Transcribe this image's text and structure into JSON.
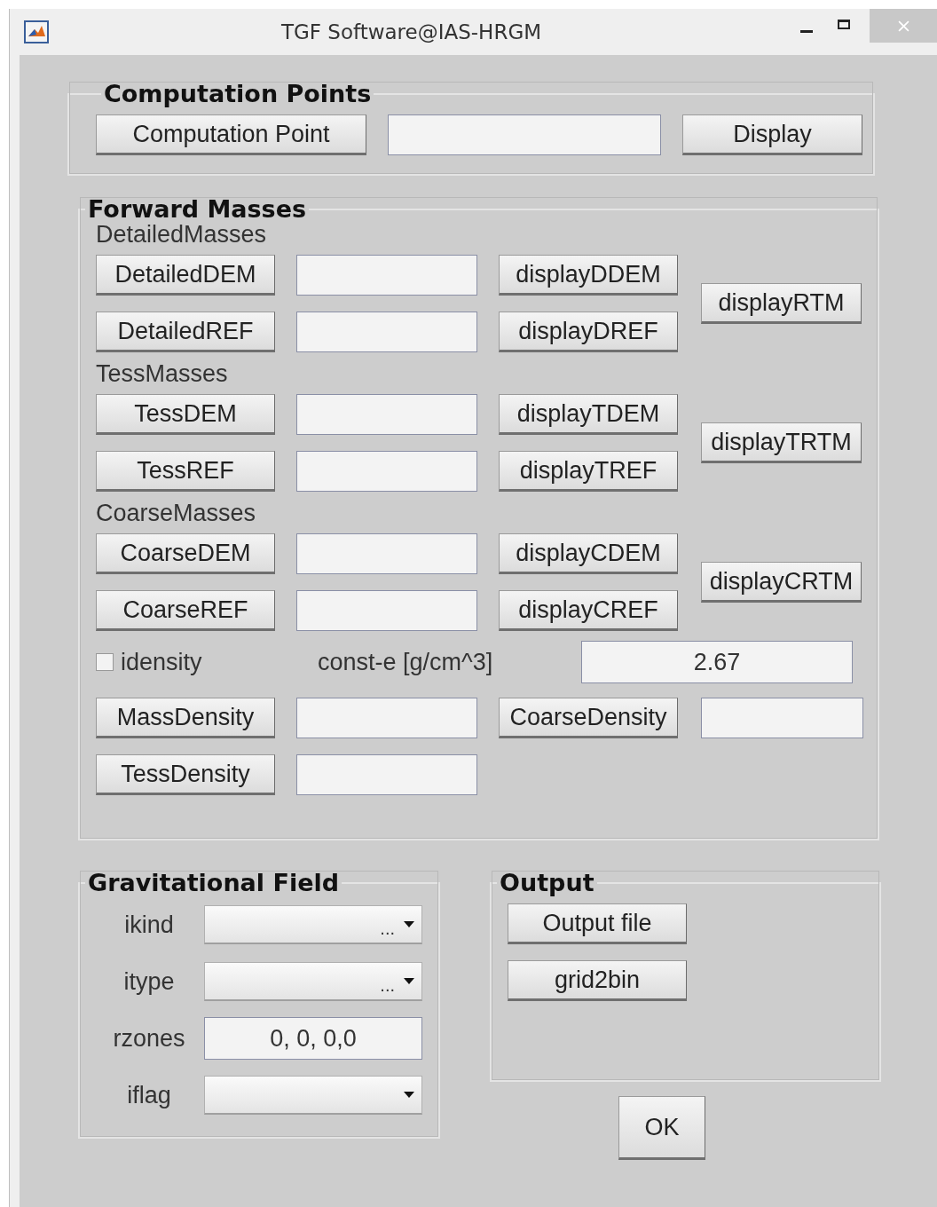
{
  "window": {
    "title": "TGF Software@IAS-HRGM"
  },
  "computation_points": {
    "title": "Computation Points",
    "button": "Computation Point",
    "display_button": "Display"
  },
  "forward_masses": {
    "title": "Forward Masses",
    "sections": [
      {
        "label": "DetailedMasses",
        "rows": [
          {
            "button": "DetailedDEM",
            "display_button": "displayDDEM"
          },
          {
            "button": "DetailedREF",
            "display_button": "displayDREF"
          }
        ],
        "side_button": "displayRTM"
      },
      {
        "label": "TessMasses",
        "rows": [
          {
            "button": "TessDEM",
            "display_button": "displayTDEM"
          },
          {
            "button": "TessREF",
            "display_button": "displayTREF"
          }
        ],
        "side_button": "displayTRTM"
      },
      {
        "label": "CoarseMasses",
        "rows": [
          {
            "button": "CoarseDEM",
            "display_button": "displayCDEM"
          },
          {
            "button": "CoarseREF",
            "display_button": "displayCREF"
          }
        ],
        "side_button": "displayCRTM"
      }
    ],
    "idensity": {
      "label": "idensity",
      "checked": false
    },
    "const_label": "const-e [g/cm^3]",
    "const_value": "2.67",
    "density_rows": [
      {
        "button": "MassDensity",
        "extra_button": "CoarseDensity"
      },
      {
        "button": "TessDensity"
      }
    ]
  },
  "gravitational_field": {
    "title": "Gravitational Field",
    "rows": [
      {
        "kind": "dropdown",
        "label": "ikind",
        "value": "..."
      },
      {
        "kind": "dropdown",
        "label": "itype",
        "value": "..."
      },
      {
        "kind": "text",
        "label": "rzones",
        "value": "0, 0, 0,0"
      },
      {
        "kind": "dropdown",
        "label": "iflag"
      }
    ]
  },
  "output": {
    "title": "Output",
    "buttons": [
      "Output file",
      "grid2bin"
    ]
  },
  "ok_button": "OK"
}
